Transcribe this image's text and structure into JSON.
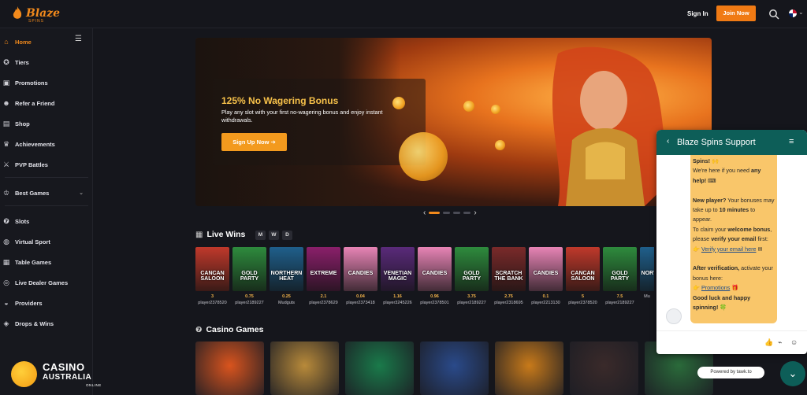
{
  "brand": {
    "name": "Blaze",
    "sub": "SPINS"
  },
  "header": {
    "signin": "Sign In",
    "join": "Join Now"
  },
  "sidebar": {
    "items": [
      {
        "label": "Home",
        "icon": "home-icon"
      },
      {
        "label": "Tiers",
        "icon": "medal-icon"
      },
      {
        "label": "Promotions",
        "icon": "gift-icon"
      },
      {
        "label": "Refer a Friend",
        "icon": "users-icon"
      },
      {
        "label": "Shop",
        "icon": "shop-icon"
      },
      {
        "label": "Achievements",
        "icon": "trophy-icon"
      },
      {
        "label": "PVP Battles",
        "icon": "swords-icon"
      },
      {
        "label": "Best Games",
        "icon": "crown-icon"
      },
      {
        "label": "Slots",
        "icon": "slots-icon"
      },
      {
        "label": "Virtual Sport",
        "icon": "ball-icon"
      },
      {
        "label": "Table Games",
        "icon": "table-icon"
      },
      {
        "label": "Live Dealer Games",
        "icon": "globe-icon"
      },
      {
        "label": "Providers",
        "icon": "provider-icon"
      },
      {
        "label": "Drops & Wins",
        "icon": "drops-icon"
      }
    ]
  },
  "banner": {
    "title": "125% No Wagering Bonus",
    "desc": "Play any slot with your first no-wagering bonus and enjoy instant withdrawals.",
    "cta": "Sign Up Now ➔"
  },
  "live_wins": {
    "title": "Live Wins",
    "filters": [
      "M",
      "W",
      "D"
    ],
    "cards": [
      {
        "game": "CANCAN SALOON",
        "amount": "3",
        "player": "player2378520",
        "bg": "#c0392b"
      },
      {
        "game": "GOLD PARTY",
        "amount": "0.75",
        "player": "player2189227",
        "bg": "#2e8b3d"
      },
      {
        "game": "NORTHERN HEAT",
        "amount": "0.25",
        "player": "Mudguts",
        "bg": "#1f5f8b"
      },
      {
        "game": "EXTREME",
        "amount": "2.1",
        "player": "player2378629",
        "bg": "#8a1f6a"
      },
      {
        "game": "CANDIES",
        "amount": "0.04",
        "player": "player2373418",
        "bg": "#e784b5"
      },
      {
        "game": "VENETIAN MAGIC",
        "amount": "1.16",
        "player": "player3245226",
        "bg": "#5a2a7a"
      },
      {
        "game": "CANDIES",
        "amount": "0.96",
        "player": "player2378501",
        "bg": "#e784b5"
      },
      {
        "game": "GOLD PARTY",
        "amount": "3.75",
        "player": "player2189227",
        "bg": "#2e8b3d"
      },
      {
        "game": "SCRATCH THE BANK",
        "amount": "2.75",
        "player": "player2318695",
        "bg": "#7a2a2a"
      },
      {
        "game": "CANDIES",
        "amount": "0.1",
        "player": "player2213130",
        "bg": "#e784b5"
      },
      {
        "game": "CANCAN SALOON",
        "amount": "5",
        "player": "player2378520",
        "bg": "#c0392b"
      },
      {
        "game": "GOLD PARTY",
        "amount": "7.5",
        "player": "player2189227",
        "bg": "#2e8b3d"
      },
      {
        "game": "NORTHERN",
        "amount": "",
        "player": "Mu",
        "bg": "#1f5f8b"
      }
    ]
  },
  "casino_games": {
    "title": "Casino Games",
    "cards": [
      "#d9541e",
      "#b88a3a",
      "#1a7a4a",
      "#2a4a8a",
      "#c87a1a",
      "#3a2a2a",
      "#2a6a3a"
    ]
  },
  "chat": {
    "title": "Blaze Spins Support",
    "powered": "Powered by tawk.to",
    "msg": {
      "l1": "Spins! 🙌",
      "l2a": "We're here if you need ",
      "l2b": "any help!",
      "l3": "New player?",
      "l3b": " Your bonuses may take up to ",
      "l3c": "10 minutes",
      "l3d": " to appear.",
      "l4": "To claim your ",
      "l4b": "welcome bonus",
      "l4c": ", please ",
      "l4d": "verify your email",
      "l4e": " first:",
      "l5": "Verify your email here",
      "l6": "After verification,",
      "l6b": " activate your bonus here:",
      "l7": "Promotions",
      "l8": "Good luck and happy spinning! 🍀"
    }
  },
  "footer_logo": {
    "t1": "CASINO",
    "t2": "AUSTRALIA",
    "t3": "ONLINE"
  }
}
